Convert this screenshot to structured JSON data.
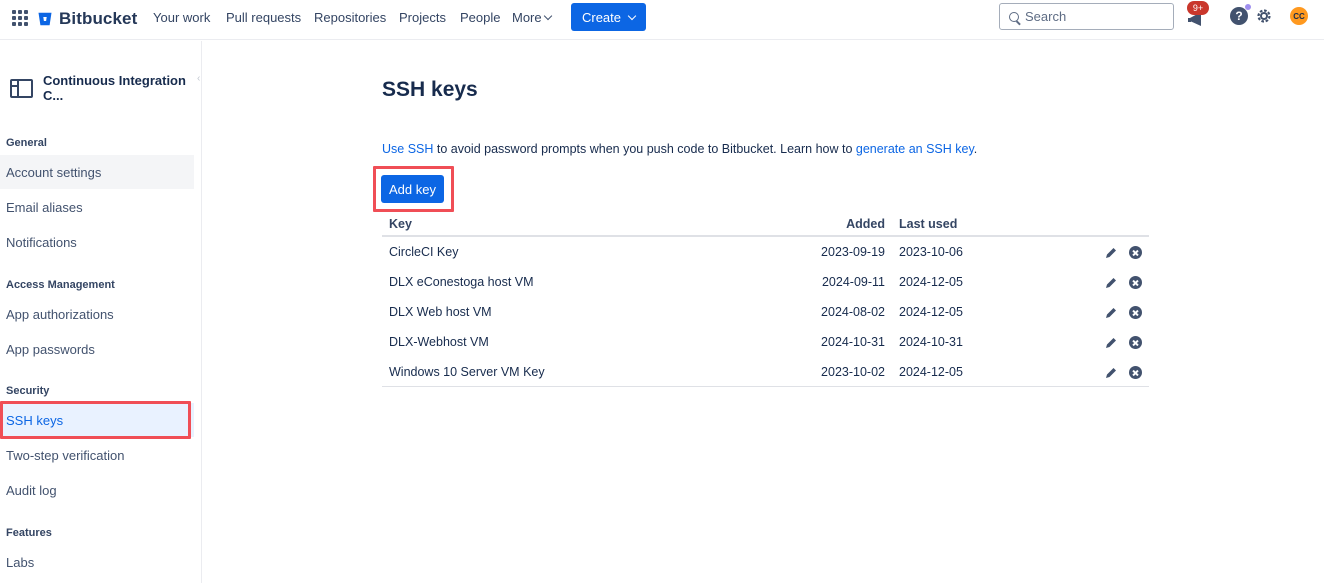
{
  "topnav": {
    "logo_text": "Bitbucket",
    "items": [
      "Your work",
      "Pull requests",
      "Repositories",
      "Projects",
      "People"
    ],
    "more_label": "More",
    "create_label": "Create",
    "search_placeholder": "Search",
    "notifications_badge": "9+",
    "help_label": "?",
    "avatar_initials": "CC",
    "brand_color": "#0c66e4"
  },
  "sidebar": {
    "workspace_title": "Continuous Integration C...",
    "sections": [
      {
        "heading": "General",
        "items": [
          "Account settings",
          "Email aliases",
          "Notifications"
        ]
      },
      {
        "heading": "Access Management",
        "items": [
          "App authorizations",
          "App passwords"
        ]
      },
      {
        "heading": "Security",
        "items": [
          "SSH keys",
          "Two-step verification",
          "Audit log"
        ]
      },
      {
        "heading": "Features",
        "items": [
          "Labs"
        ]
      }
    ],
    "active_item": "SSH keys"
  },
  "main": {
    "title": "SSH keys",
    "intro_link_1": "Use SSH",
    "intro_text": " to avoid password prompts when you push code to Bitbucket. Learn how to ",
    "intro_link_2": "generate an SSH key",
    "intro_end": ".",
    "add_key_label": "Add key",
    "table": {
      "headers": {
        "key": "Key",
        "added": "Added",
        "last_used": "Last used"
      },
      "rows": [
        {
          "name": "CircleCI Key",
          "added": "2023-09-19",
          "last_used": "2023-10-06"
        },
        {
          "name": "DLX eConestoga host VM",
          "added": "2024-09-11",
          "last_used": "2024-12-05"
        },
        {
          "name": "DLX Web host VM",
          "added": "2024-08-02",
          "last_used": "2024-12-05"
        },
        {
          "name": "DLX-Webhost VM",
          "added": "2024-10-31",
          "last_used": "2024-10-31"
        },
        {
          "name": "Windows 10 Server VM Key",
          "added": "2023-10-02",
          "last_used": "2024-12-05"
        }
      ]
    }
  },
  "highlight_color": "#f04e56"
}
